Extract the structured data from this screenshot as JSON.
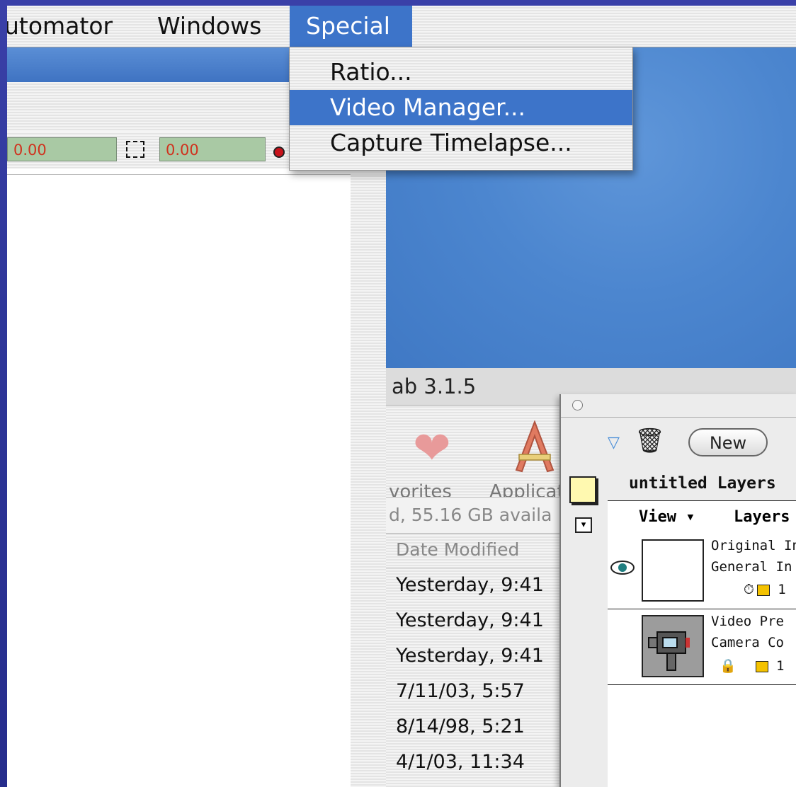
{
  "menubar": {
    "items": [
      "utomator",
      "Windows",
      "Special"
    ]
  },
  "special_menu": {
    "items": [
      "Ratio...",
      "Video Manager...",
      "Capture Timelapse..."
    ],
    "highlighted": "Video Manager..."
  },
  "left_window": {
    "field1": "0.00",
    "field2": "0.00"
  },
  "finder": {
    "title": "ab 3.1.5",
    "toolbar": {
      "favorites": "vorites",
      "applications": "Applicat"
    },
    "status": "d, 55.16 GB availa",
    "column_header": "Date Modified",
    "rows": [
      "Yesterday, 9:41",
      "Yesterday, 9:41",
      "Yesterday, 9:41",
      "7/11/03, 5:57",
      "8/14/98, 5:21",
      "4/1/03, 11:34"
    ]
  },
  "layers_palette": {
    "new_button": "New",
    "doc_title": "untitled Layers",
    "view_label": "View ▾",
    "layers_label": "Layers",
    "layers": [
      {
        "line1": "Original In",
        "line2": "General In",
        "line3": "1"
      },
      {
        "line1": "Video Pre",
        "line2": "Camera Co",
        "line3": "1"
      }
    ]
  },
  "colors": {
    "highlight": "#3d74c9",
    "field_green": "#a9c9a4",
    "field_text": "#d0321e",
    "desktop_blue": "#4c86cf"
  }
}
